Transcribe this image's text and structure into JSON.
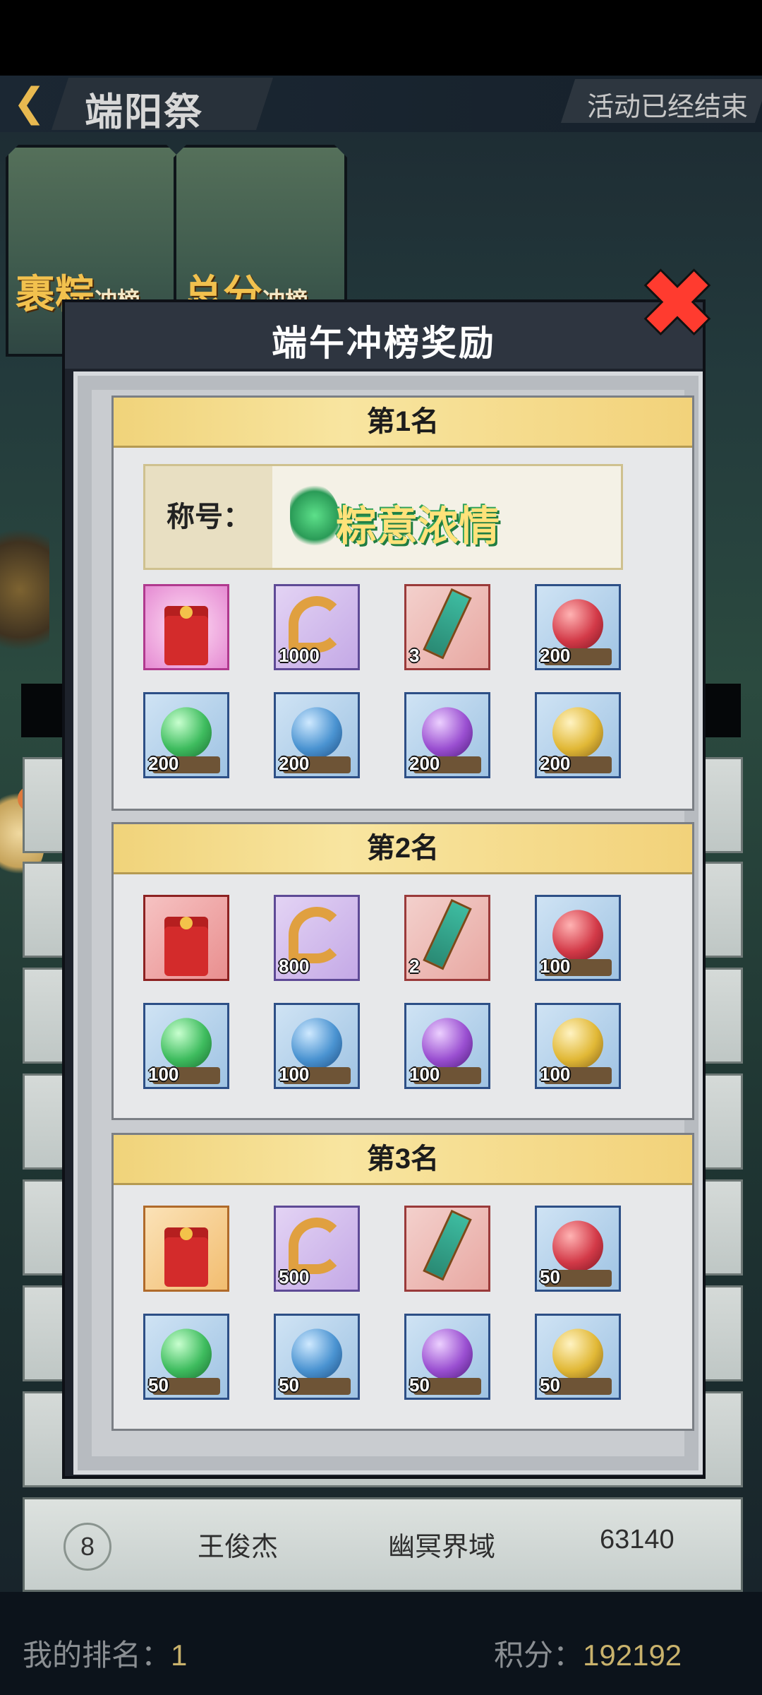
{
  "header": {
    "back_icon": "chevron-left-icon",
    "title": "端阳祭",
    "status": "活动已经结束"
  },
  "tabs": [
    {
      "label": "裹粽",
      "sub": "冲榜"
    },
    {
      "label": "总分",
      "sub": "冲榜"
    }
  ],
  "list_bottom_row": {
    "rank": "8",
    "name": "王俊杰",
    "server": "幽冥界域",
    "score": "63140"
  },
  "footer": {
    "my_rank_label": "我的排名：",
    "my_rank_value": "1",
    "score_label": "积分：",
    "score_value": "192192"
  },
  "modal": {
    "title": "端午冲榜奖励",
    "close_icon": "close-x-icon",
    "ranks": [
      {
        "header": "第1名",
        "title_label": "称号：",
        "title_name": "粽意浓情",
        "items": [
          {
            "icon": "red-envelope-icon",
            "count": ""
          },
          {
            "icon": "golden-fish-icon",
            "count": "1000"
          },
          {
            "icon": "scroll-icon",
            "count": "3"
          },
          {
            "icon": "red-orb-icon",
            "count": "200"
          },
          {
            "icon": "green-orb-icon",
            "count": "200"
          },
          {
            "icon": "blue-orb-icon",
            "count": "200"
          },
          {
            "icon": "purple-orb-icon",
            "count": "200"
          },
          {
            "icon": "gold-orb-icon",
            "count": "200"
          }
        ]
      },
      {
        "header": "第2名",
        "items": [
          {
            "icon": "red-envelope-icon",
            "count": ""
          },
          {
            "icon": "golden-fish-icon",
            "count": "800"
          },
          {
            "icon": "scroll-icon",
            "count": "2"
          },
          {
            "icon": "red-orb-icon",
            "count": "100"
          },
          {
            "icon": "green-orb-icon",
            "count": "100"
          },
          {
            "icon": "blue-orb-icon",
            "count": "100"
          },
          {
            "icon": "purple-orb-icon",
            "count": "100"
          },
          {
            "icon": "gold-orb-icon",
            "count": "100"
          }
        ]
      },
      {
        "header": "第3名",
        "items": [
          {
            "icon": "red-envelope-icon",
            "count": ""
          },
          {
            "icon": "golden-fish-icon",
            "count": "500"
          },
          {
            "icon": "scroll-icon",
            "count": ""
          },
          {
            "icon": "red-orb-icon",
            "count": "50"
          },
          {
            "icon": "green-orb-icon",
            "count": "50"
          },
          {
            "icon": "blue-orb-icon",
            "count": "50"
          },
          {
            "icon": "purple-orb-icon",
            "count": "50"
          },
          {
            "icon": "gold-orb-icon",
            "count": "50"
          }
        ]
      }
    ]
  },
  "colors": {
    "accent_gold": "#e8b950",
    "close_red": "#ff3b2f",
    "score_gold": "#c9b26c"
  }
}
